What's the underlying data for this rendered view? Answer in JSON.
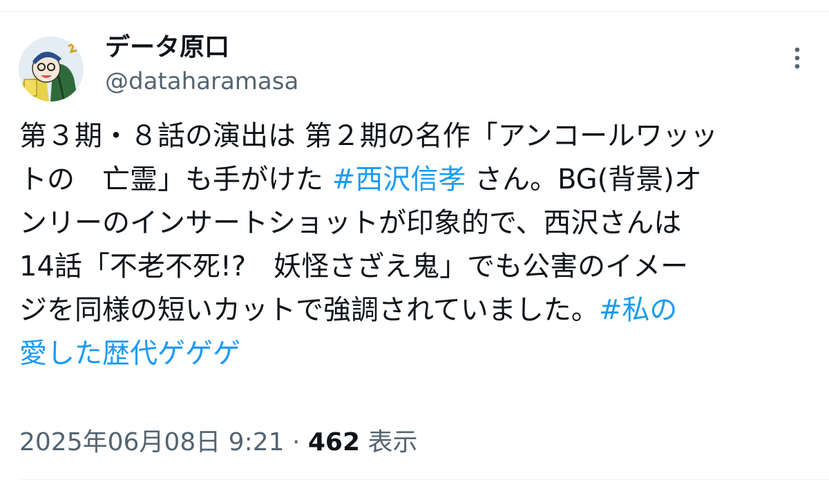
{
  "author": {
    "display_name": "データ原口",
    "handle": "@dataharamasa",
    "avatar": "avatar-illustration"
  },
  "tweet": {
    "line1": "第３期・８話の演出は 第２期の名作「アンコールワッッ",
    "line2_a": "トの　亡霊」も手がけた ",
    "hashtag1": "#西沢信孝",
    "line2_b": " さん。BG(背景)オ",
    "line3": "ンリーのインサートショットが印象的で、西沢さんは",
    "line4": "14話「不老不死!?　妖怪さざえ鬼」でも公害のイメー",
    "line5_a": "ジを同様の短いカットで強調されていました。",
    "hashtag2_a": "#私の",
    "hashtag2_b": "愛した歴代ゲゲゲ"
  },
  "meta": {
    "datetime": "2025年06月08日 9:21",
    "separator": " · ",
    "views_count": "462",
    "views_label": " 表示"
  },
  "icons": {
    "more": "more-vertical-icon"
  },
  "colors": {
    "link": "#1d9bf0",
    "text": "#0f1419",
    "secondary": "#536471"
  }
}
